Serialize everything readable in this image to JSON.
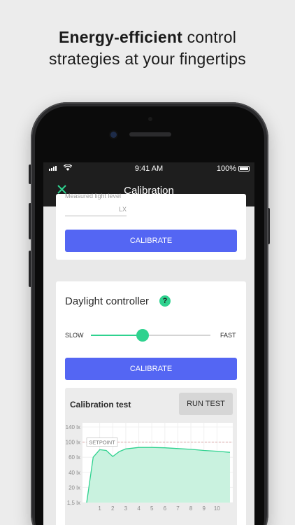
{
  "headline": {
    "bold": "Energy-efficient",
    "rest_line1": " control",
    "line2": "strategies at your fingertips"
  },
  "status_bar": {
    "time": "9:41 AM",
    "battery": "100%"
  },
  "app_bar": {
    "close_icon": "close-icon",
    "title": "Calibration"
  },
  "light_card": {
    "field_label": "Measured light level",
    "unit": "LX",
    "button": "CALIBRATE"
  },
  "daylight_card": {
    "title": "Daylight controller",
    "help": "?",
    "slow": "SLOW",
    "fast": "FAST",
    "slider_value": 0.43,
    "button": "CALIBRATE"
  },
  "calibration_test": {
    "title": "Calibration test",
    "run_button": "RUN TEST"
  },
  "colors": {
    "accent_green": "#2fd28f",
    "primary_blue": "#5466f3",
    "dark_bar": "#1e1e1e"
  },
  "chart_data": {
    "type": "area",
    "x": [
      0,
      0.5,
      1,
      1.5,
      2,
      2.5,
      3,
      4,
      5,
      6,
      7,
      8,
      9,
      10,
      11
    ],
    "y": [
      0,
      60,
      80,
      78,
      62,
      75,
      82,
      86,
      86,
      85,
      83,
      81,
      78,
      76,
      73
    ],
    "x_ticks": [
      "1",
      "2",
      "3",
      "4",
      "5",
      "6",
      "7",
      "8",
      "9",
      "10"
    ],
    "y_ticks": [
      "140 lx",
      "100 lx",
      "60 lx",
      "40 lx",
      "20 lx",
      "1,5 lx"
    ],
    "setpoint_label": "SETPOINT",
    "setpoint": 100,
    "grid": true
  }
}
